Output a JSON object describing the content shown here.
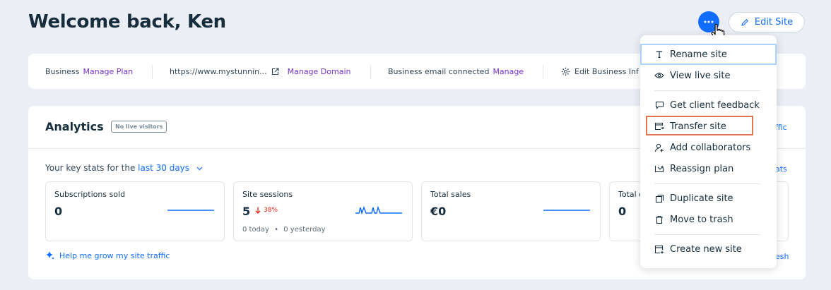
{
  "header": {
    "welcome": "Welcome back, Ken",
    "edit_site": "Edit Site"
  },
  "info_bar": {
    "plan_label": "Business",
    "plan_link": "Manage Plan",
    "domain": "https://www.mystunnin...",
    "domain_link": "Manage Domain",
    "email_label": "Business email connected",
    "email_link": "Manage",
    "edit_info": "Edit Business Inf"
  },
  "analytics": {
    "title": "Analytics",
    "badge": "No live visitors",
    "traffic_link": "ffic",
    "stats_link": "ats",
    "refresh_link": "esh",
    "key_stats_prefix": "Your key stats for the",
    "period": "last 30 days",
    "stats": [
      {
        "label": "Subscriptions sold",
        "value": "0"
      },
      {
        "label": "Site sessions",
        "value": "5",
        "change": "38%",
        "sub_today": "0 today",
        "sub_yesterday": "0 yesterday"
      },
      {
        "label": "Total sales",
        "value": "€0"
      },
      {
        "label": "Total o",
        "value": "0"
      }
    ],
    "grow_link": "Help me grow my site traffic"
  },
  "menu": {
    "items": [
      {
        "label": "Rename site",
        "icon": "text-icon"
      },
      {
        "label": "View live site",
        "icon": "eye-icon"
      },
      {
        "label": "Get client feedback",
        "icon": "chat-icon"
      },
      {
        "label": "Transfer site",
        "icon": "transfer-icon"
      },
      {
        "label": "Add collaborators",
        "icon": "add-person-icon"
      },
      {
        "label": "Reassign plan",
        "icon": "reassign-icon"
      },
      {
        "label": "Duplicate site",
        "icon": "duplicate-icon"
      },
      {
        "label": "Move to trash",
        "icon": "trash-icon"
      },
      {
        "label": "Create new site",
        "icon": "new-site-icon"
      }
    ]
  },
  "colors": {
    "accent": "#116dff",
    "link_purple": "#7634ce",
    "negative": "#e62214",
    "highlight": "#e8734f"
  }
}
